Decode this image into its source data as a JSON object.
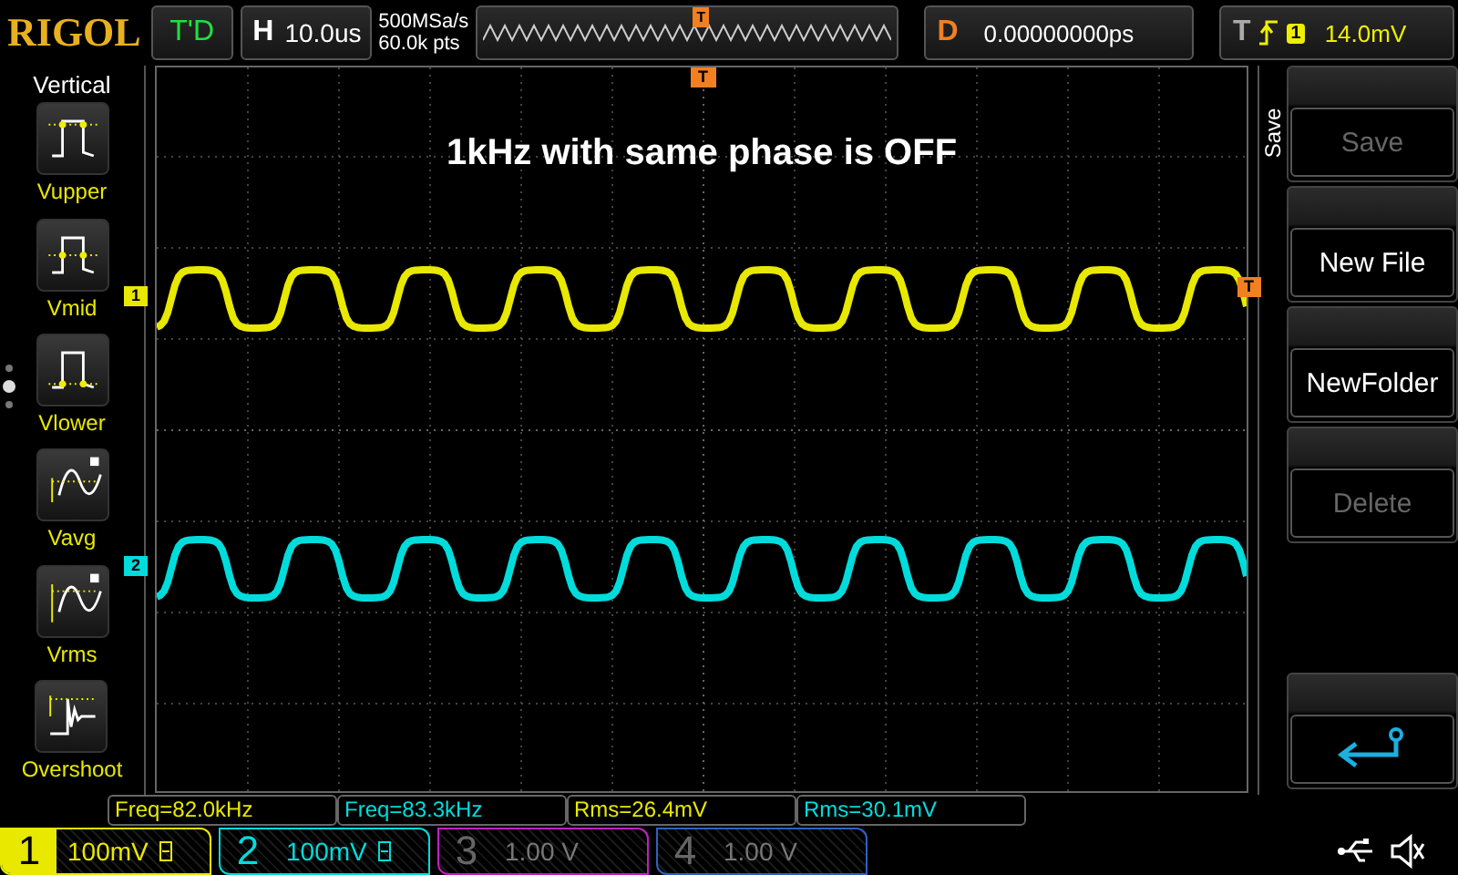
{
  "header": {
    "logo": "RIGOL",
    "run_status": "T'D",
    "horizontal": {
      "label": "H",
      "value": "10.0us"
    },
    "sample_rate": "500MSa/s",
    "memory_depth": "60.0k pts",
    "delay": {
      "label": "D",
      "value": "0.00000000ps"
    },
    "trigger": {
      "label": "T",
      "source": "1",
      "level": "14.0mV"
    }
  },
  "left_menu": {
    "title": "Vertical",
    "items": [
      {
        "label": "Vupper",
        "kind": "upper"
      },
      {
        "label": "Vmid",
        "kind": "mid"
      },
      {
        "label": "Vlower",
        "kind": "lower"
      },
      {
        "label": "Vavg",
        "kind": "avg"
      },
      {
        "label": "Vrms",
        "kind": "rms"
      },
      {
        "label": "Overshoot",
        "kind": "overshoot"
      }
    ]
  },
  "overview": {
    "trigger_position_marker": "T"
  },
  "screen": {
    "title": "1kHz with same phase is OFF",
    "trigger_position_marker": "T",
    "trigger_level_marker": "T",
    "traces": [
      {
        "marker": "1",
        "color": "#e8e800"
      },
      {
        "marker": "2",
        "color": "#00dcdc"
      }
    ]
  },
  "measurements": [
    {
      "text": "Freq=82.0kHz",
      "color": "#e8e800"
    },
    {
      "text": "Freq=83.3kHz",
      "color": "#00dcdc"
    },
    {
      "text": "Rms=26.4mV",
      "color": "#e8e800"
    },
    {
      "text": "Rms=30.1mV",
      "color": "#00dcdc"
    }
  ],
  "right_menu": {
    "title": "Save",
    "buttons": [
      {
        "kind": "text",
        "label": "Save",
        "disabled": true
      },
      {
        "kind": "text",
        "label": "New File",
        "disabled": false
      },
      {
        "kind": "text",
        "label": "NewFolder",
        "disabled": false
      },
      {
        "kind": "text",
        "label": "Delete",
        "disabled": true
      },
      {
        "kind": "back"
      }
    ]
  },
  "channels": [
    {
      "number": "1",
      "scale": "100mV",
      "on": true,
      "selected": true,
      "color": "#e8e800"
    },
    {
      "number": "2",
      "scale": "100mV",
      "on": true,
      "selected": false,
      "color": "#00dcdc"
    },
    {
      "number": "3",
      "scale": "1.00 V",
      "on": false,
      "selected": false,
      "color": "#c020c0"
    },
    {
      "number": "4",
      "scale": "1.00 V",
      "on": false,
      "selected": false,
      "color": "#3060c0"
    }
  ]
}
